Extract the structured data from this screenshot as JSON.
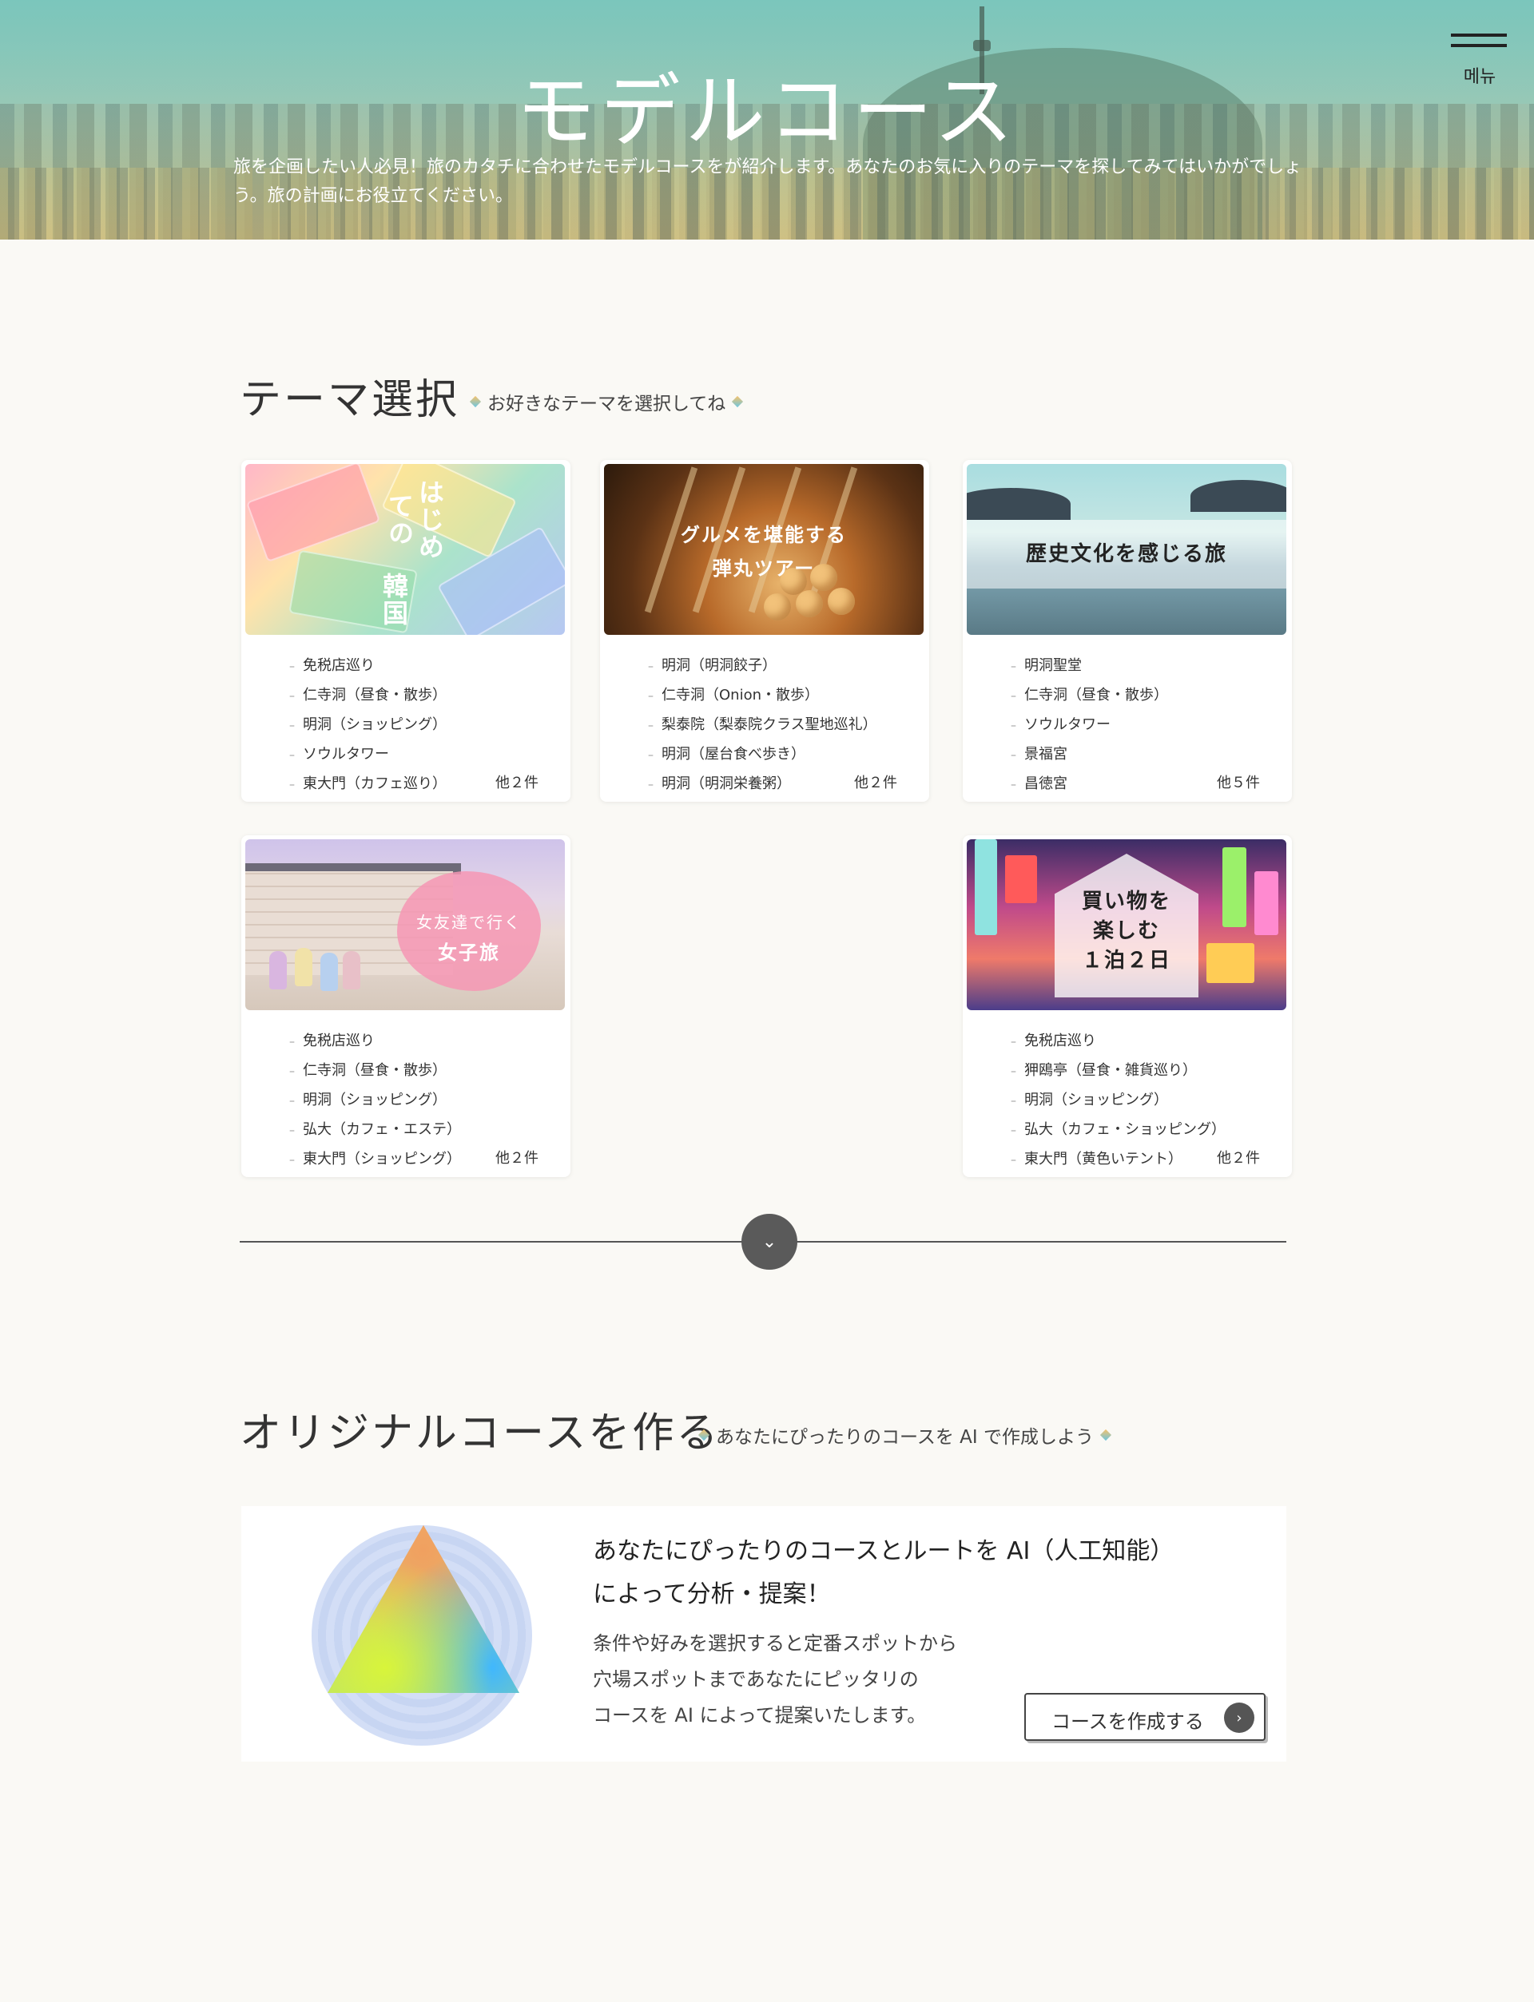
{
  "hero": {
    "title": "モデルコース",
    "description": "旅を企画したい人必見！旅のカタチに合わせたモデルコースをが紹介します。あなたのお気に入りのテーマを探してみてはいかがでしょう。旅の計画にお役立てください。"
  },
  "menu": {
    "label": "메뉴",
    "icon": "hamburger-icon"
  },
  "theme_section": {
    "title": "テーマ選択",
    "subtitle": "お好きなテーマを選択してね"
  },
  "cards": [
    {
      "caption_lines": [
        "はじめての",
        "韓国"
      ],
      "items": [
        "免税店巡り",
        "仁寺洞（昼食・散歩）",
        "明洞（ショッピング）",
        "ソウルタワー",
        "東大門（カフェ巡り）"
      ],
      "more": "他２件"
    },
    {
      "caption_lines": [
        "グルメを堪能する",
        "弾丸ツアー"
      ],
      "items": [
        "明洞（明洞餃子）",
        "仁寺洞（Onion・散歩）",
        "梨泰院（梨泰院クラス聖地巡礼）",
        "明洞（屋台食べ歩き）",
        "明洞（明洞栄養粥）"
      ],
      "more": "他２件"
    },
    {
      "caption_lines": [
        "歴史文化を感じる旅"
      ],
      "items": [
        "明洞聖堂",
        "仁寺洞（昼食・散歩）",
        "ソウルタワー",
        "景福宮",
        "昌徳宮"
      ],
      "more": "他５件"
    },
    {
      "caption_lines": [
        "女友達で行く",
        "女子旅"
      ],
      "items": [
        "免税店巡り",
        "仁寺洞（昼食・散歩）",
        "明洞（ショッピング）",
        "弘大（カフェ・エステ）",
        "東大門（ショッピング）"
      ],
      "more": "他２件"
    },
    {
      "caption_lines": [
        "買い物を",
        "楽しむ",
        "１泊２日"
      ],
      "items": [
        "免税店巡り",
        "狎鴎亭（昼食・雑貨巡り）",
        "明洞（ショッピング）",
        "弘大（カフェ・ショッピング）",
        "東大門（黄色いテント）"
      ],
      "more": "他２件"
    }
  ],
  "show_more": {
    "icon": "chevron-down-icon",
    "glyph": "⌄"
  },
  "original_section": {
    "title": "オリジナルコースを作る",
    "subtitle": "あなたにぴったりのコースを AI で作成しよう"
  },
  "ai_box": {
    "headline_1": "あなたにぴったりのコースとルートを AI（人工知能）",
    "headline_2": "によって分析・提案！",
    "text_1": "条件や好みを選択すると定番スポットから",
    "text_2": "穴場スポットまであなたにピッタリの",
    "text_3": "コースを AI によって提案いたします。",
    "button_label": "コースを作成する",
    "button_arrow": "›"
  }
}
